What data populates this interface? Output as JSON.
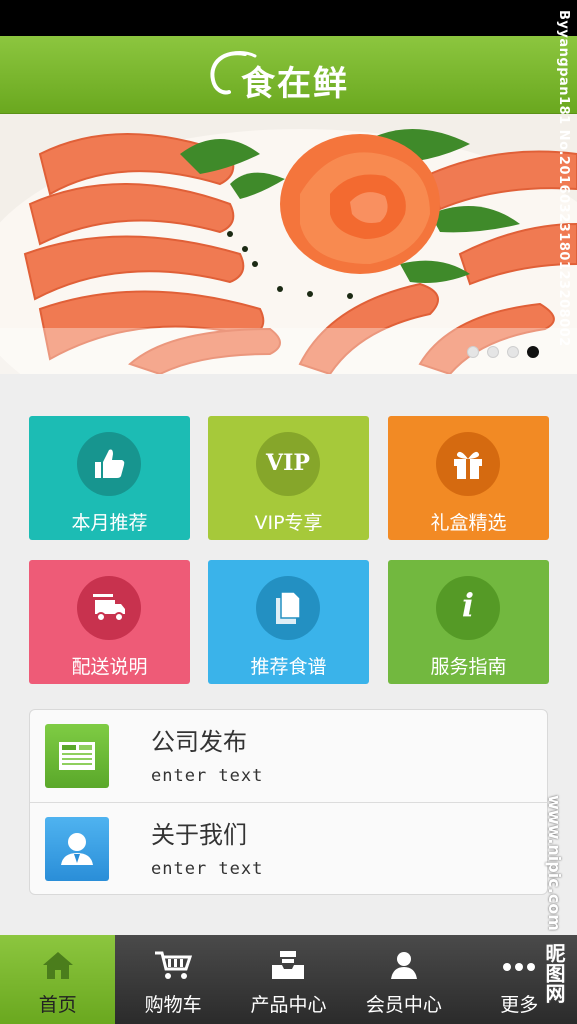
{
  "header": {
    "logo_text": "食在鲜"
  },
  "banner": {
    "slides_total": 4,
    "active_slide": 4
  },
  "tiles": [
    {
      "label": "本月推荐",
      "color": "#1cbcb4",
      "circle": "#17958f",
      "icon": "thumbs-up-icon"
    },
    {
      "label": "VIP专享",
      "color": "#a6c93a",
      "circle": "#86a62a",
      "icon": "vip-icon",
      "icon_text": "VIP"
    },
    {
      "label": "礼盒精选",
      "color": "#f28a24",
      "circle": "#d56a10",
      "icon": "gift-icon"
    },
    {
      "label": "配送说明",
      "color": "#ee5b77",
      "circle": "#c8324e",
      "icon": "delivery-truck-icon"
    },
    {
      "label": "推荐食谱",
      "color": "#3ab3ea",
      "circle": "#2390c2",
      "icon": "recipe-pages-icon"
    },
    {
      "label": "服务指南",
      "color": "#72b83f",
      "circle": "#559a26",
      "icon": "info-icon",
      "icon_text": "i"
    }
  ],
  "list": [
    {
      "title": "公司发布",
      "subtitle": "enter text",
      "icon": "news-icon",
      "color": "#6dbd34"
    },
    {
      "title": "关于我们",
      "subtitle": "enter text",
      "icon": "user-profile-icon",
      "color": "#3aa0e4"
    }
  ],
  "tabbar": [
    {
      "label": "首页",
      "icon": "home-icon",
      "active": true
    },
    {
      "label": "购物车",
      "icon": "cart-icon",
      "active": false
    },
    {
      "label": "产品中心",
      "icon": "inbox-icon",
      "active": false
    },
    {
      "label": "会员中心",
      "icon": "member-icon",
      "active": false
    },
    {
      "label": "更多",
      "icon": "more-dots-icon",
      "active": false
    }
  ],
  "watermark": {
    "side_text": "Byyangpan181 No.20160323180123208002",
    "site_text": "www.nipic.com",
    "brand_text": "昵图网"
  }
}
